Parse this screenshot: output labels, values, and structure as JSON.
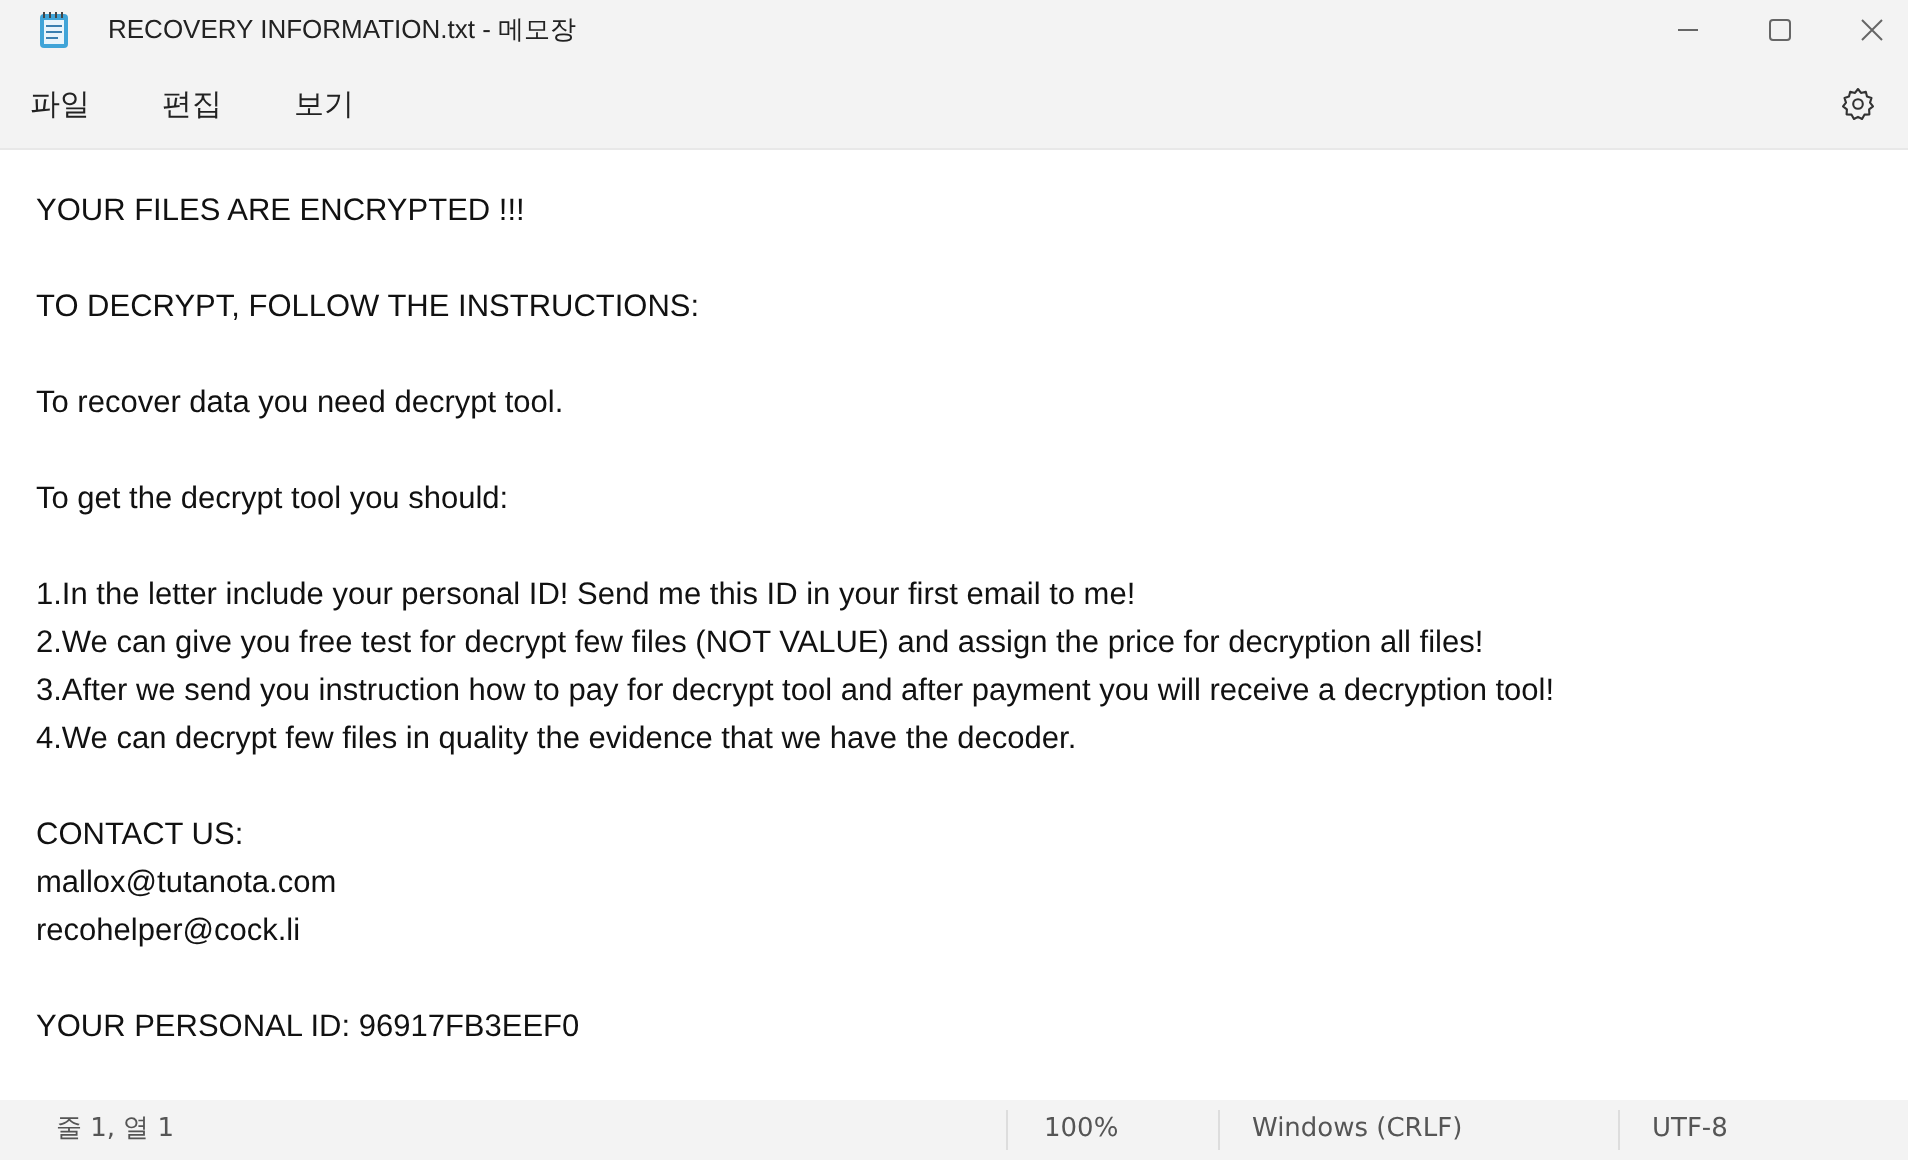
{
  "window": {
    "title": "RECOVERY INFORMATION.txt - 메모장"
  },
  "menu": [
    "파일",
    "편집",
    "보기"
  ],
  "document": {
    "paragraphs": [
      [
        "YOUR FILES ARE ENCRYPTED !!!"
      ],
      [
        "TO DECRYPT, FOLLOW THE INSTRUCTIONS:"
      ],
      [
        "To recover data you need decrypt tool."
      ],
      [
        "To get the decrypt tool you should:"
      ],
      [
        "1.In the letter include your personal ID! Send me this ID in your first email to me!",
        "2.We can give you free test for decrypt few files (NOT VALUE) and assign the price for decryption all files!",
        "3.After we send you instruction how to pay for decrypt tool and after payment you will receive a decryption tool!",
        "4.We can decrypt few files in quality the evidence that we have the decoder."
      ],
      [
        "CONTACT US:",
        "mallox@tutanota.com",
        "recohelper@cock.li"
      ],
      [
        "YOUR PERSONAL ID: 96917FB3EEF0"
      ]
    ]
  },
  "status_bar": {
    "position": "줄 1, 열 1",
    "zoom": "100%",
    "line_ending": "Windows (CRLF)",
    "encoding": "UTF-8"
  }
}
